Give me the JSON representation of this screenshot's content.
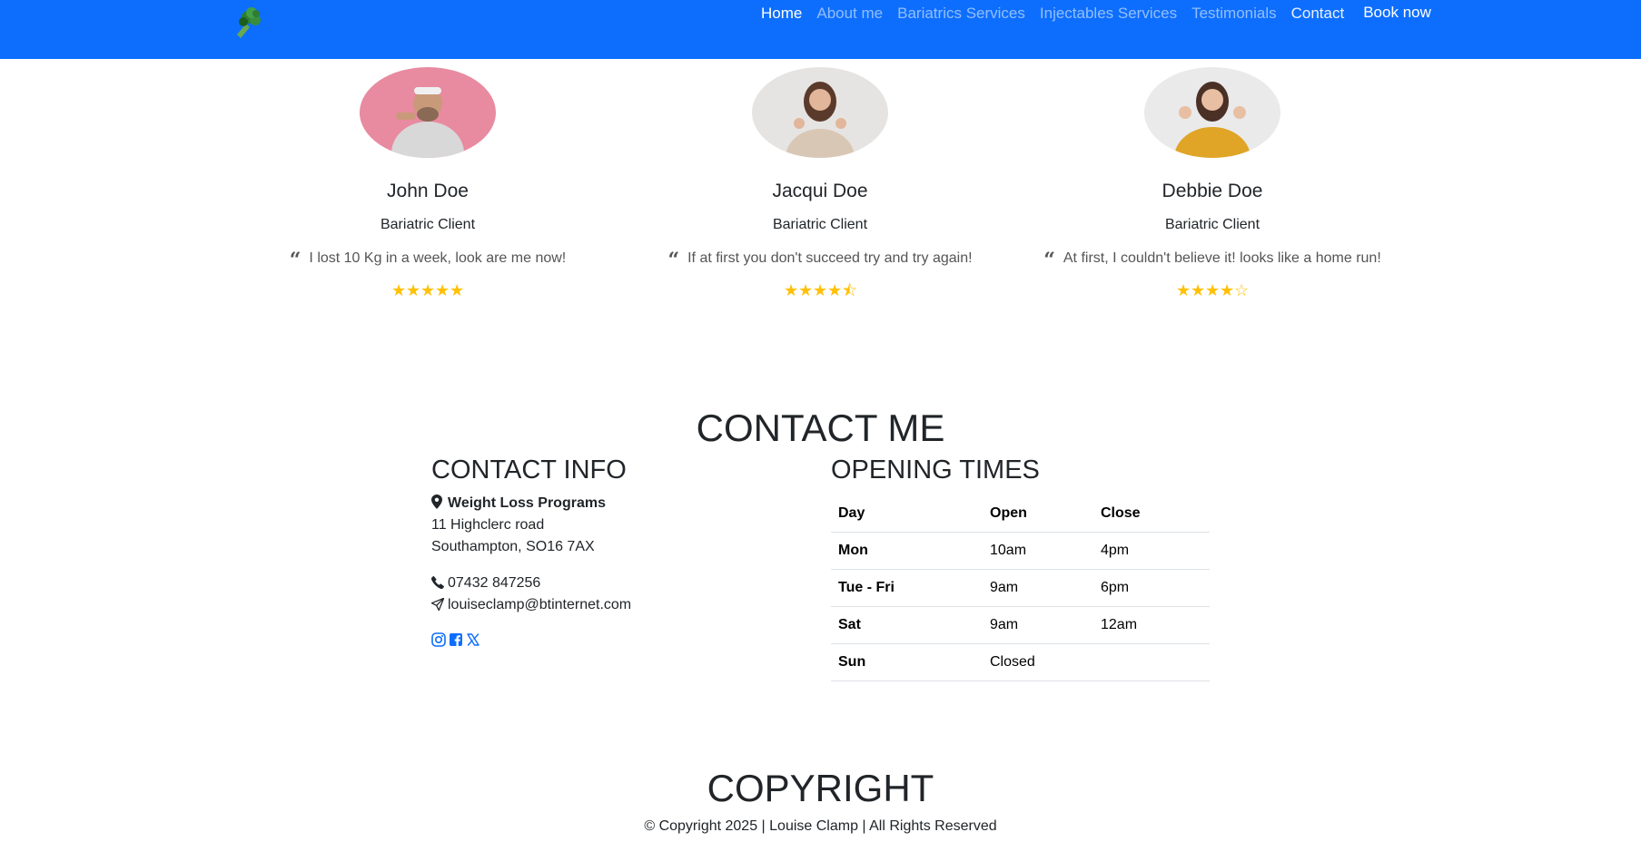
{
  "nav": {
    "logo_icon": "broccoli-icon",
    "links": [
      "Home",
      "About me",
      "Bariatrics Services",
      "Injectables Services",
      "Testimonials",
      "Contact"
    ],
    "book_label": "Book now",
    "bar_color": "#0d6efd"
  },
  "testimonials": [
    {
      "name": "John Doe",
      "role": "Bariatric Client",
      "quote": "I lost 10 Kg in a week, look are me now!",
      "rating": 5
    },
    {
      "name": "Jacqui Doe",
      "role": "Bariatric Client",
      "quote": "If at first you don't succeed try and try again!",
      "rating": 4.5
    },
    {
      "name": "Debbie Doe",
      "role": "Bariatric Client",
      "quote": "At first, I couldn't believe it! looks like a home run!",
      "rating": 4
    }
  ],
  "contact": {
    "heading": "CONTACT ME",
    "info_heading": "CONTACT INFO",
    "business": "Weight Loss Programs",
    "address_line1": "11 Highclerc road",
    "address_line2": "Southampton, SO16 7AX",
    "phone": "07432 847256",
    "email": "louiseclamp@btinternet.com",
    "social_icons": [
      "instagram-icon",
      "facebook-icon",
      "x-twitter-icon"
    ],
    "hours_heading": "OPENING TIMES",
    "hours_headers": [
      "Day",
      "Open",
      "Close"
    ],
    "hours_rows": [
      [
        "Mon",
        "10am",
        "4pm"
      ],
      [
        "Tue - Fri",
        "9am",
        "6pm"
      ],
      [
        "Sat",
        "9am",
        "12am"
      ],
      [
        "Sun",
        "Closed",
        ""
      ]
    ]
  },
  "footer": {
    "heading": "COPYRIGHT",
    "text": "© Copyright 2025 | Louise Clamp | All Rights Reserved"
  }
}
